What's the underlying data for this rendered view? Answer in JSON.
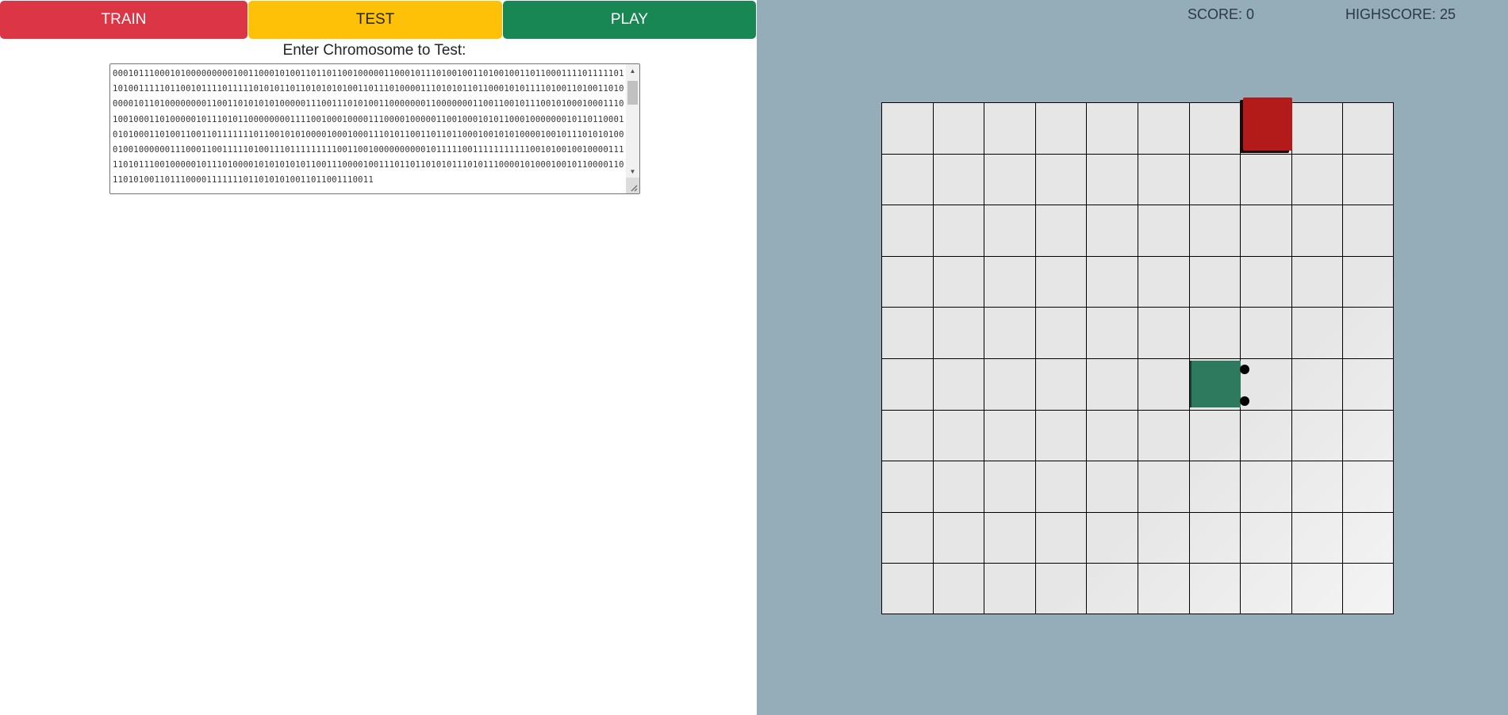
{
  "modes": {
    "train_label": "TRAIN",
    "test_label": "TEST",
    "play_label": "PLAY"
  },
  "test_panel": {
    "prompt": "Enter Chromosome to Test:",
    "chromosome": "0001011100010100000000010011000101001101101100100000110001011101001001101001001101100011110111110110100111110110010111101111101010110110101010100110111010000111010101101100010101111010011010011010000010110100000000110011010101010000011100111010100110000000110000000110011001011100101000100011101001000110100000101110101100000000111100100010000111000010000011001000101011000100000001011011000101010001101001100110111111101100101010000100010001110101100110110110001001010100001001011101010100010010000001110001100111110100111011111111100110010000000000101111100111111111110010100100100001111101011100100000101110100001010101010110011100001001110110110101011101011100001010001001011000011011010100110111000011111110110101010011011001110011"
  },
  "scoreboard": {
    "score_text": "SCORE: 0",
    "highscore_text": "HIGHSCORE: 25",
    "score": 0,
    "highscore": 25
  },
  "game": {
    "grid_columns": 10,
    "grid_rows": 10,
    "food_cell": {
      "col": 7,
      "row": 0
    },
    "snake_head_cell": {
      "col": 6,
      "row": 5
    },
    "snake_direction": "right",
    "colors": {
      "background": "#95adb8",
      "board": "#e6e6e6",
      "food": "#b31a1a",
      "snake": "#2e7a5e",
      "train": "#dc3545",
      "test": "#ffc107",
      "play": "#198754"
    }
  }
}
